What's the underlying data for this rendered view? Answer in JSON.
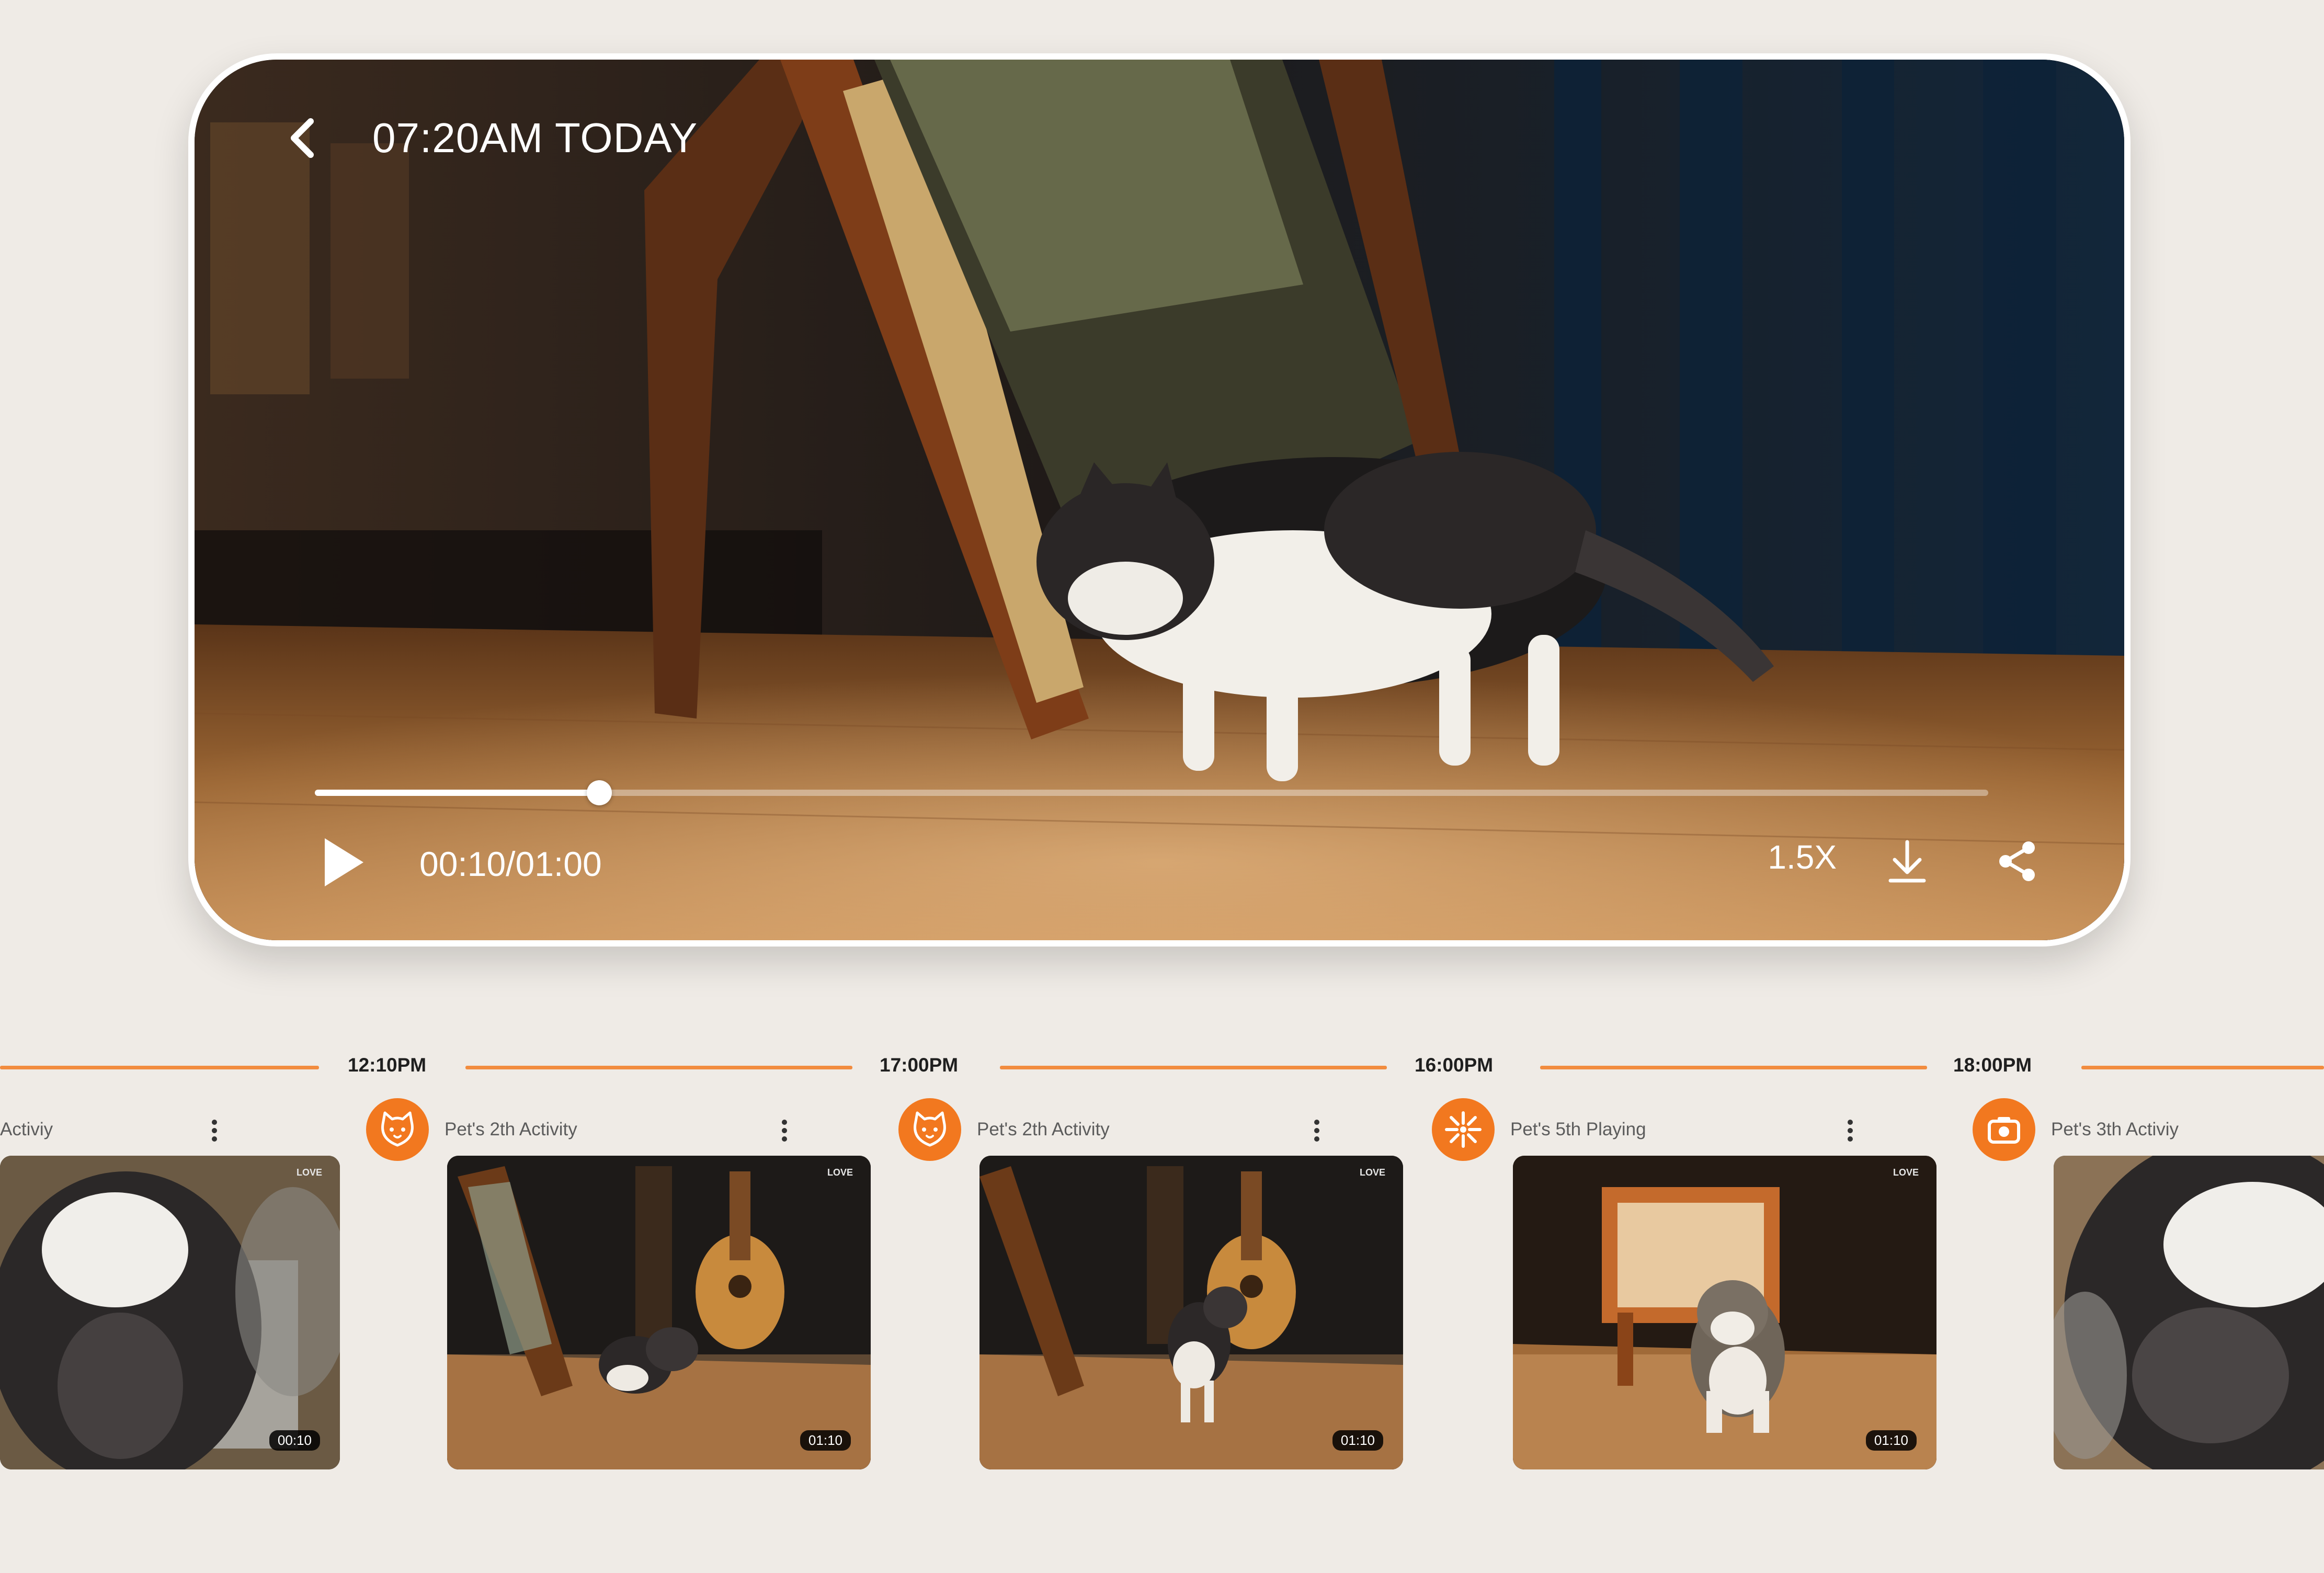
{
  "player": {
    "title": "07:20AM TODAY",
    "current_time": "00:10/01:00",
    "progress": 0.17,
    "speed": "1.5X"
  },
  "timeline": {
    "markers": [
      "12:10PM",
      "17:00PM",
      "16:00PM",
      "18:00PM"
    ]
  },
  "cards": [
    {
      "label": "Activiy",
      "icon": "activity-icon",
      "duration": "00:10",
      "watermark": "LOVE"
    },
    {
      "label": "Pet's 2th Activity",
      "icon": "cat-face-icon",
      "duration": "01:10",
      "watermark": "LOVE"
    },
    {
      "label": "Pet's 2th Activity",
      "icon": "cat-face-icon",
      "duration": "01:10",
      "watermark": "LOVE"
    },
    {
      "label": "Pet's 5th Playing",
      "icon": "sparkle-icon",
      "duration": "01:10",
      "watermark": "LOVE"
    },
    {
      "label": "Pet's 3th Activiy",
      "icon": "camera-icon",
      "duration": "",
      "watermark": ""
    }
  ],
  "colors": {
    "accent": "#f2781f",
    "timeline": "#f28c3f",
    "background": "#efebe6"
  }
}
